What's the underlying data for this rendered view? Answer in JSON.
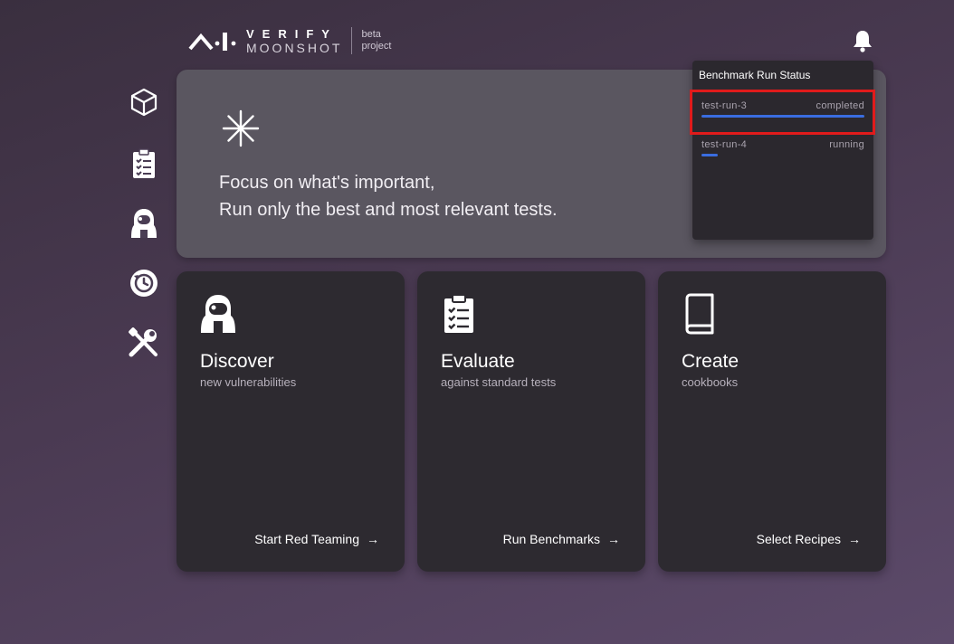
{
  "logo": {
    "verify": "VERIFY",
    "moonshot": "MOONSHOT",
    "beta_line1": "beta",
    "beta_line2": "project"
  },
  "header": {
    "notification_icon": "bell-icon"
  },
  "sidebar": {
    "items": [
      {
        "icon": "cube-icon"
      },
      {
        "icon": "clipboard-checklist-icon"
      },
      {
        "icon": "astronaut-icon"
      },
      {
        "icon": "history-icon"
      },
      {
        "icon": "tools-icon"
      }
    ]
  },
  "hero": {
    "icon": "asterisk-icon",
    "line1": "Focus on what's important,",
    "line2": "Run only the best and most relevant tests."
  },
  "status_panel": {
    "title": "Benchmark Run Status",
    "runs": [
      {
        "name": "test-run-3",
        "status": "completed",
        "progress": 1.0
      },
      {
        "name": "test-run-4",
        "status": "running",
        "progress": 0.1
      }
    ],
    "progress_color": "#3a6de0"
  },
  "cards": [
    {
      "icon": "astronaut-icon",
      "title": "Discover",
      "subtitle": "new vulnerabilities",
      "action": "Start Red Teaming"
    },
    {
      "icon": "clipboard-checklist-icon",
      "title": "Evaluate",
      "subtitle": "against standard tests",
      "action": "Run Benchmarks"
    },
    {
      "icon": "book-icon",
      "title": "Create",
      "subtitle": "cookbooks",
      "action": "Select Recipes"
    }
  ],
  "colors": {
    "highlight": "#e01b1b",
    "card_bg": "#2d2a30",
    "hero_bg": "#5a5660"
  }
}
